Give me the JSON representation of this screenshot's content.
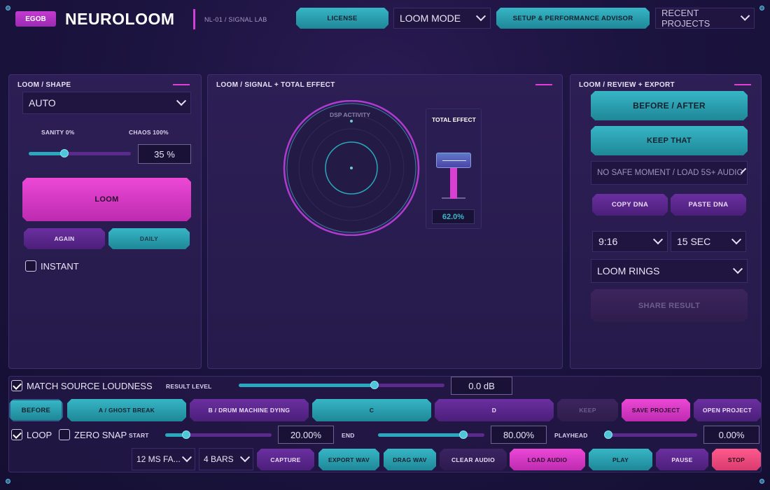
{
  "header": {
    "badge": "EGOB",
    "brand": "NEUROLOOM",
    "subtitle": "NL-01  /  SIGNAL LAB",
    "license_label": "LICENSE",
    "mode_select": "LOOM MODE",
    "advisor_label": "SETUP & PERFORMANCE ADVISOR",
    "recent_select": "RECENT PROJECTS"
  },
  "shape_panel": {
    "title": "LOOM  /  SHAPE",
    "mode_select": "AUTO",
    "sanity_label": "SANITY 0%",
    "chaos_label": "CHAOS 100%",
    "chaos_value": "35 %",
    "chaos_fraction": 0.35,
    "loom_label": "LOOM",
    "again_label": "AGAIN",
    "daily_label": "DAILY",
    "instant_label": "INSTANT"
  },
  "signal_panel": {
    "title": "LOOM  /  SIGNAL + TOTAL EFFECT",
    "dsp_label": "DSP ACTIVITY",
    "total_effect_label": "TOTAL EFFECT",
    "total_effect_value": "62.0%",
    "total_effect_fraction": 0.62
  },
  "review_panel": {
    "title": "LOOM  /  REVIEW + EXPORT",
    "before_after_label": "BEFORE / AFTER",
    "keep_that_label": "KEEP THAT",
    "moment_select": "NO SAFE MOMENT / LOAD 5S+ AUDIO",
    "copy_dna_label": "COPY DNA",
    "paste_dna_label": "PASTE DNA",
    "aspect_select": "9:16",
    "duration_select": "15 SEC",
    "style_select": "LOOM RINGS",
    "share_label": "SHARE RESULT"
  },
  "bottom": {
    "match_label": "MATCH SOURCE LOUDNESS",
    "result_level_label": "RESULT LEVEL",
    "result_level_value": "0.0 dB",
    "result_level_fraction": 0.66,
    "slots": {
      "before": "BEFORE",
      "a": "A / GHOST BREAK",
      "b": "B / DRUM MACHINE DYING",
      "c": "C",
      "d": "D",
      "keep": "KEEP",
      "save": "SAVE PROJECT",
      "open": "OPEN PROJECT"
    },
    "loop_label": "LOOP",
    "zero_snap_label": "ZERO SNAP",
    "start_label": "START",
    "start_value": "20.00%",
    "start_fraction": 0.2,
    "end_label": "END",
    "end_value": "80.00%",
    "end_fraction": 0.8,
    "playhead_label": "PLAYHEAD",
    "playhead_value": "0.00%",
    "playhead_fraction": 0.0,
    "fade_select": "12 MS FA...",
    "bars_select": "4 BARS",
    "capture_label": "CAPTURE",
    "export_wav_label": "EXPORT WAV",
    "drag_wav_label": "DRAG WAV",
    "clear_audio_label": "CLEAR AUDIO",
    "load_audio_label": "LOAD AUDIO",
    "play_label": "PLAY",
    "pause_label": "PAUSE",
    "stop_label": "STOP"
  },
  "colors": {
    "accent_pink": "#e03fd5",
    "accent_teal": "#29a8c0",
    "accent_purple": "#5a2a8c"
  }
}
